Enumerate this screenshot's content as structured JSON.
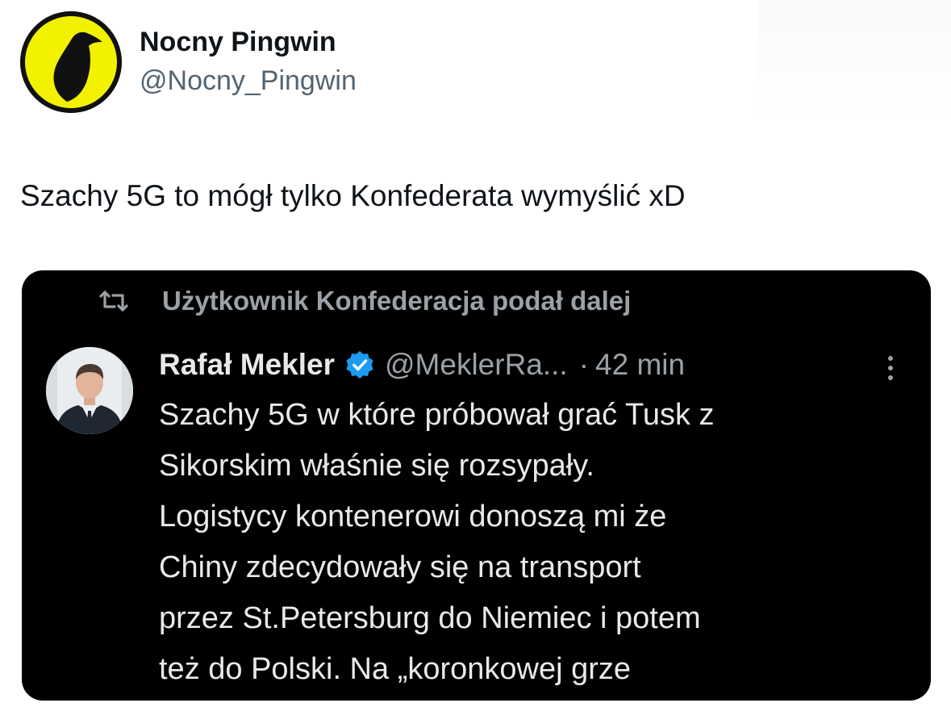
{
  "author": {
    "display_name": "Nocny Pingwin",
    "handle": "@Nocny_Pingwin",
    "avatar_icon": "penguin-silhouette-icon",
    "avatar_accent": "#f2f200"
  },
  "tweet": {
    "text": "Szachy 5G to mógł tylko Konfederata wymyślić xD"
  },
  "quoted": {
    "retweet_label": "Użytkownik Konfederacja podał dalej",
    "retweet_icon": "retweet-icon",
    "author_name": "Rafał Mekler",
    "verified_icon": "verified-badge-icon",
    "author_handle": "@MeklerRa...",
    "separator": "·",
    "time": "42 min",
    "more_icon": "more-vertical-icon",
    "body_lines": [
      "Szachy 5G w które próbował grać Tusk z",
      "Sikorskim właśnie się rozsypały.",
      "Logistycy kontenerowi donoszą mi że",
      "Chiny zdecydowały się na transport",
      "przez St.Petersburg do Niemiec i potem",
      "też do Polski. Na „koronkowej grze"
    ]
  },
  "colors": {
    "card_background": "#000000",
    "verified_blue": "#1d9bf0",
    "muted_text": "#9ba1a6"
  }
}
